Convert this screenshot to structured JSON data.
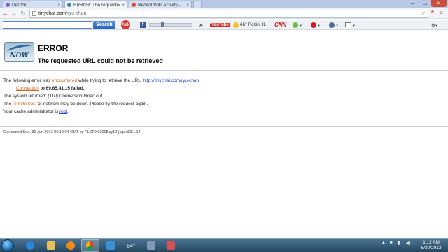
{
  "tabs": [
    {
      "title": "Derrick",
      "active": false,
      "color": "#7d6bc0"
    },
    {
      "title": "ERROR: The requested URL",
      "active": true,
      "color": "#3a87c7"
    },
    {
      "title": "Recent Wiki Activity - Th",
      "active": false,
      "color": "#e34a2c"
    }
  ],
  "address_bar": {
    "domain": "tinychat.com",
    "path": "/ryu-chan"
  },
  "ask_toolbar": {
    "search_label": "Search",
    "ask_logo": "Ask",
    "weather": "65° Pekin, IL",
    "youtube": "YouTube",
    "cnn": "CNN"
  },
  "error_page": {
    "title": "ERROR",
    "subtitle": "The requested URL could not be retrieved",
    "line1_pre": "The following error was ",
    "line1_link": "encountered",
    "line1_mid": " while trying to retrieve the URL: ",
    "line1_url": "http://tinychat.com/ryu-chan",
    "line2_link": "Connection",
    "line2_post": " to 69.65.41.15 failed.",
    "line3_pre": "The system returned: ",
    "line3_err": "(110) Connection timed out",
    "line4_pre": "The ",
    "line4_link": "remote host",
    "line4_post": " or network may be down. Please try the request again.",
    "line5_pre": "Your cache administrator is ",
    "line5_link": "root",
    "line5_post": ".",
    "generated": "Generated Sun, 30 Jun 2013 06:10:04 GMT by FLORX0200Bay10 (squid/3.1.14)"
  },
  "taskbar": {
    "weather": "64°",
    "time": "1:12 AM",
    "date": "6/30/2013"
  },
  "colors": {
    "link": "#1a3fd1",
    "orange_link": "#d5651e",
    "close_button": "#c94c3c"
  }
}
